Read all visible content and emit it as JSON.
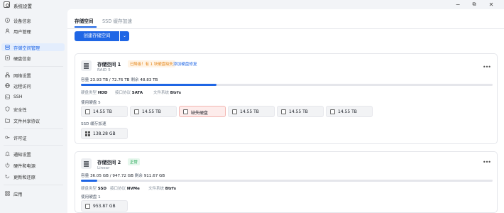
{
  "window": {
    "title": "系统设置"
  },
  "sidebar": {
    "items": [
      {
        "label": "设备信息",
        "icon": "info-icon"
      },
      {
        "label": "用户管理",
        "icon": "user-icon"
      },
      {
        "label": "存储空间管理",
        "icon": "storage-icon",
        "active": true
      },
      {
        "label": "硬盘信息",
        "icon": "disk-icon"
      },
      {
        "label": "网络设置",
        "icon": "network-icon"
      },
      {
        "label": "远程访问",
        "icon": "globe-icon"
      },
      {
        "label": "SSH",
        "icon": "terminal-icon"
      },
      {
        "label": "安全性",
        "icon": "shield-icon"
      },
      {
        "label": "文件共享协议",
        "icon": "folder-icon"
      },
      {
        "label": "许可证",
        "icon": "key-icon"
      },
      {
        "label": "通知设置",
        "icon": "bell-icon"
      },
      {
        "label": "硬件和电源",
        "icon": "power-icon"
      },
      {
        "label": "更新和还原",
        "icon": "refresh-icon"
      },
      {
        "label": "应用",
        "icon": "apps-icon"
      }
    ]
  },
  "tabs": [
    {
      "label": "存储空间",
      "active": true
    },
    {
      "label": "SSD 缓存加速",
      "active": false
    }
  ],
  "create_button": {
    "label": "创建存储空间"
  },
  "pools": [
    {
      "name": "存储空间 1",
      "raid": "RAID 5",
      "status": "已降级！有 1 块硬盘缺失",
      "action": "添加硬盘修复",
      "capacity_label": "容量",
      "used": "23.93 TB / 72.76 TB",
      "remaining_label": "剩余",
      "remaining": "48.83 TB",
      "usage_fraction": 0.33,
      "disk_type_label": "硬盘类型",
      "disk_type": "HDD",
      "interface_label": "接口协议",
      "interface": "SATA",
      "fs_label": "文件系统",
      "fs": "Btrfs",
      "disks_label": "使用硬盘 5",
      "disks": [
        "14.55 TB",
        "14.55 TB",
        "缺失硬盘",
        "14.55 TB",
        "14.55 TB",
        "14.55 TB"
      ],
      "cache_label": "SSD 缓存加速",
      "cache": "138.28 GB"
    },
    {
      "name": "存储空间 2",
      "raid": "Linear",
      "status": "正常",
      "capacity_label": "容量",
      "used": "36.05 GB / 947.72 GB",
      "remaining_label": "剩余",
      "remaining": "911.67 GB",
      "usage_fraction": 0.04,
      "disk_type_label": "硬盘类型",
      "disk_type": "SSD",
      "interface_label": "接口协议",
      "interface": "NVMe",
      "fs_label": "文件系统",
      "fs": "Btrfs",
      "disks_label": "使用硬盘 1",
      "disks": [
        "953.87 GB"
      ]
    }
  ],
  "colors": {
    "accent": "#1f66e5",
    "warning": "#e5861a",
    "success": "#17a34a",
    "missing_bg": "#fdeceb"
  }
}
